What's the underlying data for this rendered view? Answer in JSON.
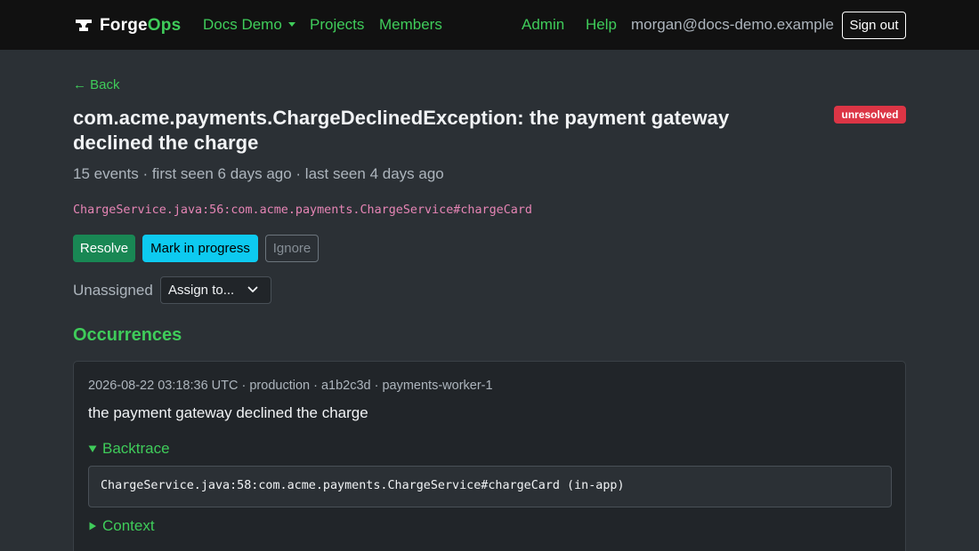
{
  "nav": {
    "brand_part1": "Forge",
    "brand_part2": "Ops",
    "project_dropdown": "Docs Demo",
    "projects": "Projects",
    "members": "Members",
    "admin": "Admin",
    "help": "Help",
    "user_email": "morgan@docs-demo.example",
    "sign_out": "Sign out"
  },
  "issue": {
    "back": "← Back",
    "title": "com.acme.payments.ChargeDeclinedException: the payment gateway declined the charge",
    "status": "unresolved",
    "meta": "15 events · first seen 6 days ago · last seen 4 days ago",
    "location": "ChargeService.java:56:com.acme.payments.ChargeService#chargeCard"
  },
  "actions": {
    "resolve": "Resolve",
    "in_progress": "Mark in progress",
    "ignore": "Ignore"
  },
  "assignment": {
    "label": "Unassigned",
    "select_value": "Assign to..."
  },
  "occurrences": {
    "heading": "Occurrences",
    "items": [
      {
        "meta": "2026-08-22 03:18:36 UTC · production · a1b2c3d · payments-worker-1",
        "message": "the payment gateway declined the charge",
        "backtrace_label": "Backtrace",
        "backtrace_frame": "ChargeService.java:58:com.acme.payments.ChargeService#chargeCard (in-app)",
        "context_label": "Context"
      }
    ]
  },
  "colors": {
    "accent": "#3fcc5a",
    "danger": "#dc3545",
    "success": "#198754",
    "info": "#0dcaf0",
    "code": "#e685b5"
  },
  "icons": {
    "brand": "anvil-icon",
    "dropdown": "caret-down-icon",
    "select": "chevron-down-icon",
    "expanded": "triangle-down-icon",
    "collapsed": "triangle-right-icon"
  }
}
